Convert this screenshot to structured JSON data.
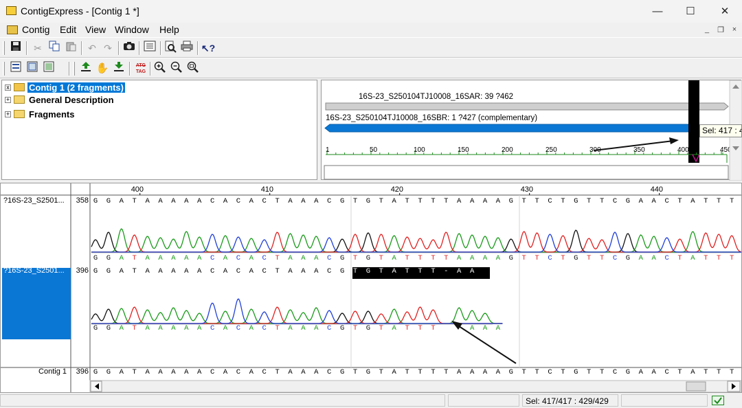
{
  "window": {
    "title": "ContigExpress - [Contig 1 *]",
    "minimize_glyph": "—",
    "maximize_glyph": "☐",
    "close_glyph": "✕"
  },
  "menu": {
    "items": [
      "Contig",
      "Edit",
      "View",
      "Window",
      "Help"
    ],
    "mdi_minimize": "_",
    "mdi_restore": "❐",
    "mdi_close": "×"
  },
  "toolbar1": {
    "icons": [
      "save-icon",
      "cut-icon",
      "copy-icon",
      "paste-icon",
      "undo-icon",
      "redo-icon",
      "camera-icon",
      "properties-icon",
      "find-icon",
      "print-icon",
      "context-help-icon"
    ]
  },
  "toolbar2": {
    "icons": [
      "view-alignment-icon",
      "view-text-icon",
      "view-map-icon",
      "move-up-icon",
      "hand-icon",
      "move-down-icon",
      "tag-icon",
      "zoom-in-icon",
      "zoom-out-icon",
      "zoom-fit-icon"
    ],
    "tag_label_top": "ATG",
    "tag_label_bottom": "TAG"
  },
  "tree": {
    "items": [
      {
        "expander": "x",
        "label": "Contig 1 (2 fragments)",
        "selected": true
      },
      {
        "expander": "+",
        "label": "General Description",
        "selected": false
      },
      {
        "expander": "+",
        "label": "Fragments",
        "selected": false
      }
    ]
  },
  "overview": {
    "fragment1_label": "16S-23_S250104TJ10008_16SAR: 39 ?462",
    "fragment2_label": "16S-23_S250104TJ10008_16SBR: 1 ?427 (complementary)",
    "ruler_ticks": [
      "1",
      "50",
      "100",
      "150",
      "200",
      "250",
      "300",
      "350",
      "400",
      "450"
    ],
    "sel_tooltip": "Sel: 417 : 4"
  },
  "alignment": {
    "ruler_ticks": [
      "400",
      "410",
      "420",
      "430",
      "440"
    ],
    "rows": [
      {
        "name": "?16S-23_S2501...",
        "position": "358",
        "selected": false
      },
      {
        "name": "?16S-23_S2501...",
        "position": "396",
        "selected": true
      },
      {
        "name": "Contig 1",
        "position": "396",
        "selected": false
      }
    ],
    "seq1": "GGATAAAAACACACTAAACGTGTATTTTAAAAGTTCTGTTCGAACTATTT",
    "seq1_called": "GGATAAAAACACACTAAACGTGTATTTTAAAAGTTCTGTTCGAACTATTT",
    "seq2": "GGATAAAAACACACTAAACGTGTATTT-AAA",
    "seq2_called": "GGATAAAAACACACTAAACGTGTATTT  AAA",
    "contig": "GGATAAAAACACACTAAACGTGTATTTTAAAAGTTCTGTTCGAACTATTT",
    "highlight_start": 20,
    "highlight_end": 30
  },
  "status": {
    "selection": "Sel: 417/417 : 429/429"
  },
  "colors": {
    "A": "#1a9a1a",
    "C": "#1f3fd8",
    "G": "#111111",
    "T": "#e02020",
    "selection": "#0078d7"
  }
}
